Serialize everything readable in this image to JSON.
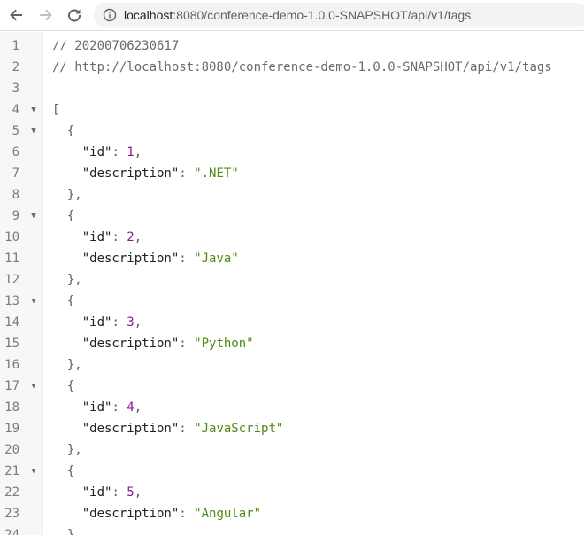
{
  "browser": {
    "back_icon": "arrow-left-icon",
    "forward_icon": "arrow-right-icon",
    "reload_icon": "reload-icon",
    "info_icon": "info-icon",
    "url_host": "localhost",
    "url_rest": ":8080/conference-demo-1.0.0-SNAPSHOT/api/v1/tags"
  },
  "viewer": {
    "comment_timestamp": "// 20200706230617",
    "comment_url": "// http://localhost:8080/conference-demo-1.0.0-SNAPSHOT/api/v1/tags",
    "array_open": "[",
    "object_open": "{",
    "object_close_comma": "},",
    "key_id": "\"id\"",
    "key_description": "\"description\"",
    "colon": ": ",
    "comma": ",",
    "fold_icon": "▼",
    "line_numbers": [
      "1",
      "2",
      "3",
      "4",
      "5",
      "6",
      "7",
      "8",
      "9",
      "10",
      "11",
      "12",
      "13",
      "14",
      "15",
      "16",
      "17",
      "18",
      "19",
      "20",
      "21",
      "22",
      "23",
      "24"
    ],
    "tags": [
      {
        "id": "1",
        "description": "\".NET\""
      },
      {
        "id": "2",
        "description": "\"Java\""
      },
      {
        "id": "3",
        "description": "\"Python\""
      },
      {
        "id": "4",
        "description": "\"JavaScript\""
      },
      {
        "id": "5",
        "description": "\"Angular\""
      }
    ],
    "last_partial": "}"
  }
}
